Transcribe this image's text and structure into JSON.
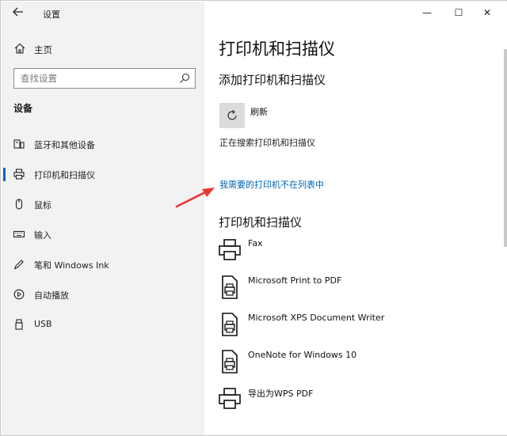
{
  "window": {
    "app_title": "设置",
    "back_icon": "back-arrow-icon",
    "controls": {
      "minimize": "—",
      "maximize": "☐",
      "close": "✕"
    }
  },
  "sidebar": {
    "home_label": "主页",
    "search_placeholder": "查找设置",
    "section_title": "设备",
    "items": [
      {
        "label": "蓝牙和其他设备",
        "icon": "bluetooth-devices-icon"
      },
      {
        "label": "打印机和扫描仪",
        "icon": "printer-icon",
        "active": true
      },
      {
        "label": "鼠标",
        "icon": "mouse-icon"
      },
      {
        "label": "输入",
        "icon": "keyboard-icon"
      },
      {
        "label": "笔和 Windows Ink",
        "icon": "pen-icon"
      },
      {
        "label": "自动播放",
        "icon": "autoplay-icon"
      },
      {
        "label": "USB",
        "icon": "usb-icon"
      }
    ]
  },
  "main": {
    "title": "打印机和扫描仪",
    "add_title": "添加打印机和扫描仪",
    "refresh_label": "刷新",
    "searching_text": "正在搜索打印机和扫描仪",
    "missing_link": "我需要的打印机不在列表中",
    "devices_title": "打印机和扫描仪",
    "devices": [
      {
        "name": "Fax",
        "icon": "fax-printer-icon"
      },
      {
        "name": "Microsoft Print to PDF",
        "icon": "document-printer-icon"
      },
      {
        "name": "Microsoft XPS Document Writer",
        "icon": "document-printer-icon"
      },
      {
        "name": "OneNote for Windows 10",
        "icon": "document-printer-icon"
      },
      {
        "name": "导出为WPS PDF",
        "icon": "printer-icon"
      }
    ]
  },
  "colors": {
    "accent": "#0067c0",
    "link": "#0063b1",
    "sidebar_bg": "#f2f2f2",
    "annotation_arrow": "#e53935"
  }
}
